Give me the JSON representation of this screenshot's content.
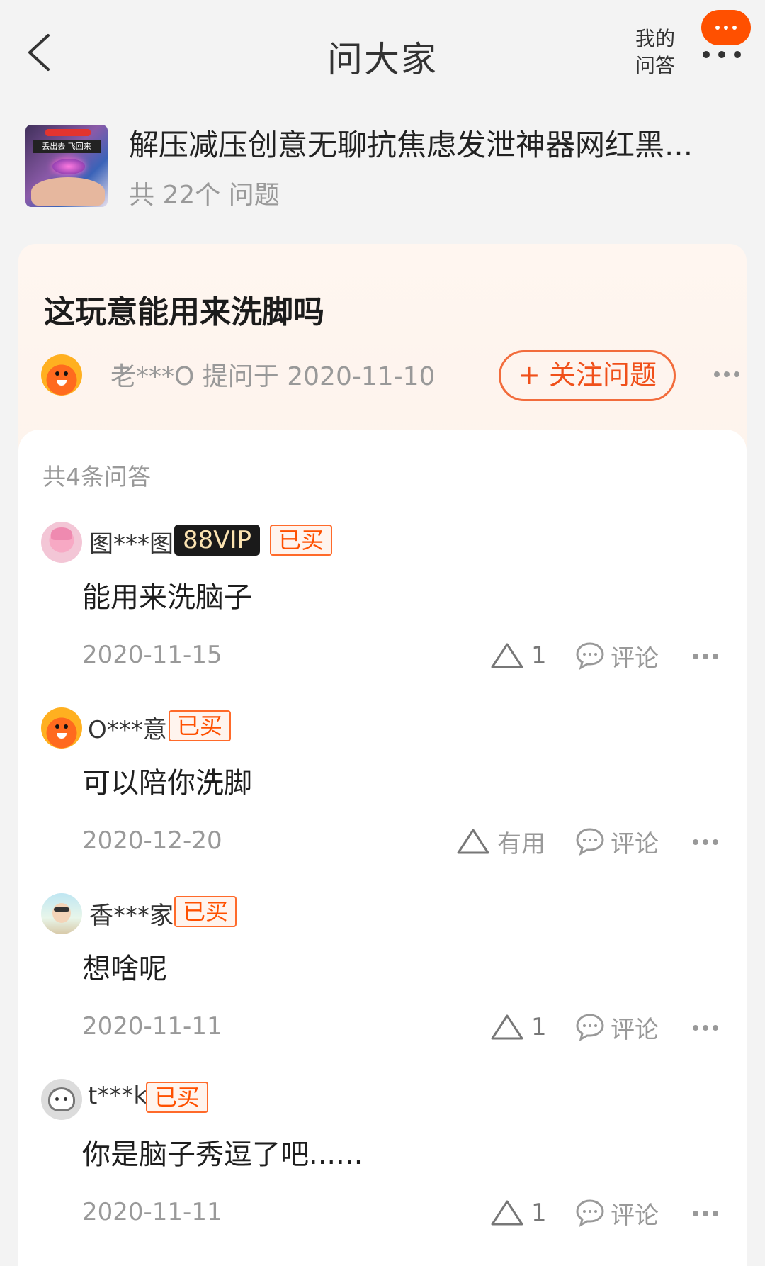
{
  "header": {
    "title": "问大家",
    "my_qa": "我的问答"
  },
  "product": {
    "image_banner_text": "丢出去 飞回来",
    "name": "解压减压创意无聊抗焦虑发泄神器网红黑...",
    "question_count": "共 22个 问题"
  },
  "question": {
    "text": "这玩意能用来洗脚吗",
    "asker": "老***O",
    "asked_label": "提问于 2020-11-10",
    "follow_label": "+ 关注问题"
  },
  "answers_header": "共4条问答",
  "answers": [
    {
      "user": "图***图",
      "vip": "88VIP",
      "bought": "已买",
      "text": "能用来洗脑子",
      "date": "2020-11-15",
      "like": "1",
      "comment": "评论",
      "avatar": "pink-avatar"
    },
    {
      "user": "O***意",
      "bought": "已买",
      "text": "可以陪你洗脚",
      "date": "2020-12-20",
      "like": "有用",
      "comment": "评论",
      "avatar": "orange-avatar"
    },
    {
      "user": "香***家",
      "bought": "已买",
      "text": "想啥呢",
      "date": "2020-11-11",
      "like": "1",
      "comment": "评论",
      "avatar": "sky-avatar"
    },
    {
      "user": "t***k",
      "bought": "已买",
      "text": "你是脑子秀逗了吧......",
      "date": "2020-11-11",
      "like": "1",
      "comment": "评论",
      "avatar": "gray-avatar"
    }
  ],
  "colors": {
    "accent": "#ff5000",
    "background": "#f3f3f3",
    "question_card": "#fdf3ec"
  }
}
